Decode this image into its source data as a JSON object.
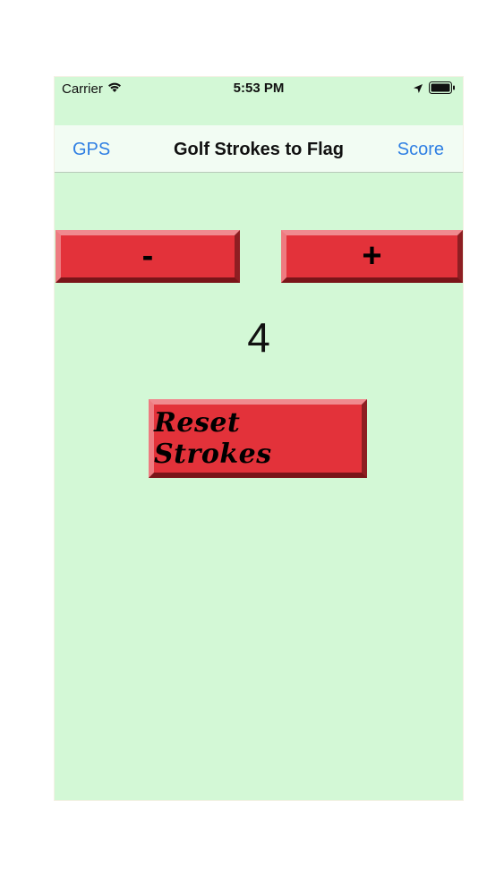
{
  "status_bar": {
    "carrier": "Carrier",
    "time": "5:53 PM"
  },
  "nav": {
    "left_label": "GPS",
    "title": "Golf Strokes to Flag",
    "right_label": "Score"
  },
  "controls": {
    "minus_label": "-",
    "plus_label": "+",
    "stroke_count": "4",
    "reset_label": "Reset Strokes"
  },
  "colors": {
    "background": "#d3f8d6",
    "button_red": "#e3323a",
    "link_blue": "#2f7fe3"
  }
}
